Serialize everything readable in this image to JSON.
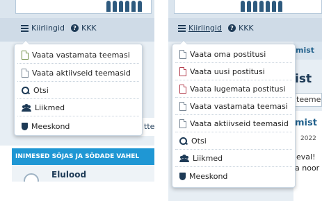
{
  "navbar": {
    "forums_label": "Kiirlingid",
    "faq_label": "KKK"
  },
  "left_menu": {
    "items": [
      {
        "label": "Vaata vastamata teemasi",
        "icon": "doc-icon"
      },
      {
        "label": "Vaata aktiivseid teemasid",
        "icon": "doc-icon"
      },
      {
        "label": "Otsi",
        "icon": "search-icon"
      },
      {
        "label": "Liikmed",
        "icon": "users-icon"
      },
      {
        "label": "Meeskond",
        "icon": "shield-icon"
      }
    ]
  },
  "right_menu": {
    "items": [
      {
        "label": "Vaata oma postitusi",
        "icon": "doc-icon"
      },
      {
        "label": "Vaata uusi postitusi",
        "icon": "doc-icon-red"
      },
      {
        "label": "Vaata lugemata postitusi",
        "icon": "doc-icon-red"
      },
      {
        "label": "Vaata vastamata teemasi",
        "icon": "doc-icon"
      },
      {
        "label": "Vaata aktiivseid teemasid",
        "icon": "doc-icon"
      },
      {
        "label": "Otsi",
        "icon": "search-icon"
      },
      {
        "label": "Liikmed",
        "icon": "users-icon"
      },
      {
        "label": "Meeskond",
        "icon": "shield-icon"
      }
    ]
  },
  "left_background": {
    "section_header": "INIMESED SÕJAS JA SÕDADE VAHEL",
    "forum_title": "Elulood",
    "partial_text": "tte"
  },
  "right_background": {
    "fragment_1": "mist",
    "fragment_2": "ist",
    "fragment_3": "teeme",
    "fragment_4": "mist",
    "fragment_5": "2022",
    "fragment_6": "eval!",
    "fragment_7": "a noor"
  }
}
